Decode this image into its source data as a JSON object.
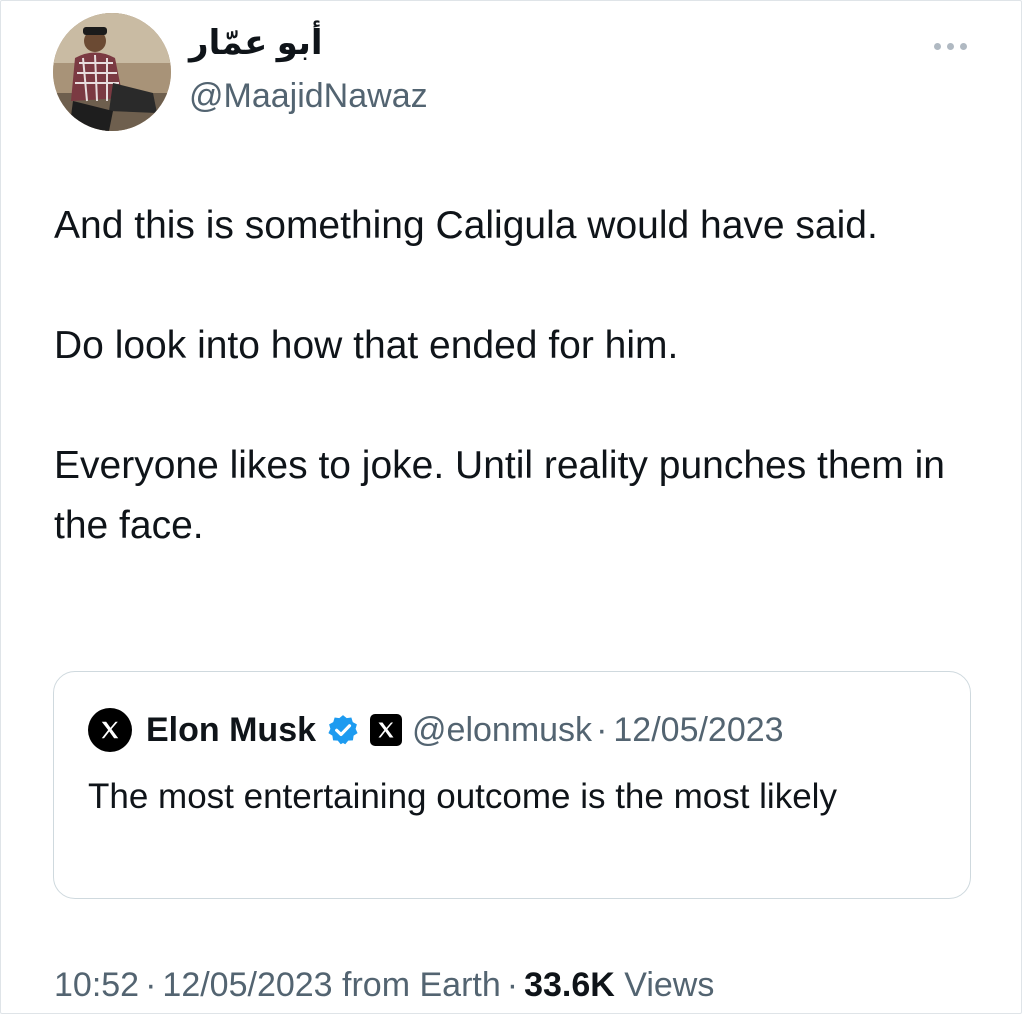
{
  "author": {
    "display_name": "أبو عمّار",
    "handle": "@MaajidNawaz",
    "avatar_icon": "profile-photo"
  },
  "tweet": {
    "paragraphs": [
      "And this is something Caligula would have said.",
      "Do look into how that ended for him.",
      "Everyone likes to joke. Until reality punches them in the face."
    ]
  },
  "quoted_tweet": {
    "name": "Elon Musk",
    "verified_icon": "verified-badge-icon",
    "affiliation_icon": "x-logo-icon",
    "handle": "@elonmusk",
    "separator": "·",
    "date": "12/05/2023",
    "text": "The most entertaining outcome is the most likely"
  },
  "meta": {
    "time": "10:52",
    "separator": "·",
    "date_source": "12/05/2023 from Earth",
    "views_count": "33.6K",
    "views_label": "Views"
  },
  "colors": {
    "text": "#0f1419",
    "secondary": "#536471",
    "verified": "#1d9bf0",
    "border": "#cfd9de"
  }
}
